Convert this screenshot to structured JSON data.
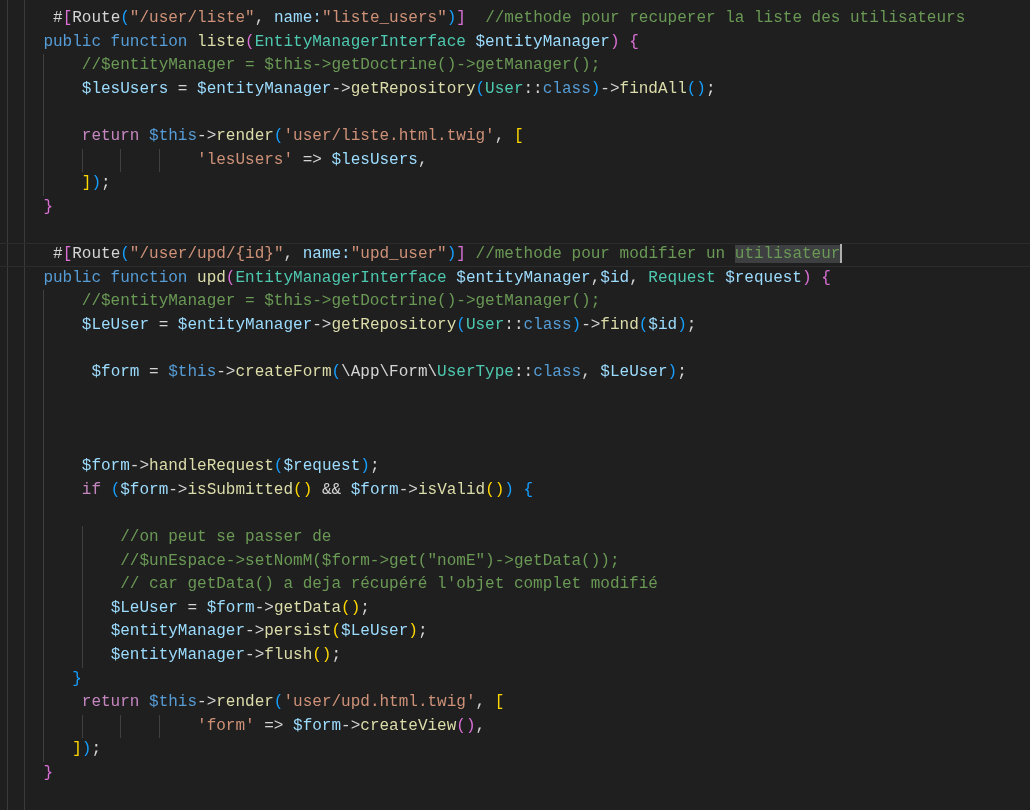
{
  "editor": {
    "lines": [
      {
        "current": false,
        "tokens": [
          {
            "kind": "op",
            "text": "     #"
          },
          {
            "kind": "b1",
            "text": "["
          },
          {
            "kind": "op",
            "text": "Route"
          },
          {
            "kind": "b2",
            "text": "("
          },
          {
            "kind": "str",
            "text": "\"/user/liste\""
          },
          {
            "kind": "op",
            "text": ", "
          },
          {
            "kind": "var",
            "text": "name:"
          },
          {
            "kind": "str",
            "text": "\"liste_users\""
          },
          {
            "kind": "b2",
            "text": ")"
          },
          {
            "kind": "b1",
            "text": "]"
          },
          {
            "kind": "com",
            "text": "  //methode pour recuperer la liste des utilisateurs"
          }
        ]
      },
      {
        "current": false,
        "tokens": [
          {
            "kind": "kw",
            "text": "    public function "
          },
          {
            "kind": "fn",
            "text": "liste"
          },
          {
            "kind": "b1",
            "text": "("
          },
          {
            "kind": "type",
            "text": "EntityManagerInterface "
          },
          {
            "kind": "var",
            "text": "$entityManager"
          },
          {
            "kind": "b1",
            "text": ")"
          },
          {
            "kind": "b1",
            "text": " {"
          }
        ]
      },
      {
        "current": false,
        "tokens": [
          {
            "kind": "com",
            "text": "        //$entityManager = $this->getDoctrine()->getManager();"
          }
        ]
      },
      {
        "current": false,
        "tokens": [
          {
            "kind": "var",
            "text": "        $lesUsers"
          },
          {
            "kind": "op",
            "text": " = "
          },
          {
            "kind": "var",
            "text": "$entityManager"
          },
          {
            "kind": "op",
            "text": "->"
          },
          {
            "kind": "fn",
            "text": "getRepository"
          },
          {
            "kind": "b2",
            "text": "("
          },
          {
            "kind": "type",
            "text": "User"
          },
          {
            "kind": "op",
            "text": "::"
          },
          {
            "kind": "kw",
            "text": "class"
          },
          {
            "kind": "b2",
            "text": ")"
          },
          {
            "kind": "op",
            "text": "->"
          },
          {
            "kind": "fn",
            "text": "findAll"
          },
          {
            "kind": "b2",
            "text": "()"
          },
          {
            "kind": "op",
            "text": ";"
          }
        ]
      },
      {
        "current": false
      },
      {
        "current": false,
        "tokens": [
          {
            "kind": "ctl",
            "text": "        return "
          },
          {
            "kind": "kw",
            "text": "$this"
          },
          {
            "kind": "op",
            "text": "->"
          },
          {
            "kind": "fn",
            "text": "render"
          },
          {
            "kind": "b2",
            "text": "("
          },
          {
            "kind": "str",
            "text": "'user/liste.html.twig'"
          },
          {
            "kind": "op",
            "text": ", "
          },
          {
            "kind": "b3",
            "text": "["
          }
        ]
      },
      {
        "current": false,
        "tokens": [
          {
            "kind": "str",
            "text": "                    'lesUsers'"
          },
          {
            "kind": "op",
            "text": " => "
          },
          {
            "kind": "var",
            "text": "$lesUsers"
          },
          {
            "kind": "op",
            "text": ","
          }
        ]
      },
      {
        "current": false,
        "tokens": [
          {
            "kind": "b3",
            "text": "        ]"
          },
          {
            "kind": "b2",
            "text": ")"
          },
          {
            "kind": "op",
            "text": ";"
          }
        ]
      },
      {
        "current": false,
        "tokens": [
          {
            "kind": "b1",
            "text": "    }"
          }
        ]
      },
      {
        "current": false
      },
      {
        "current": true,
        "tokens": [
          {
            "kind": "op",
            "text": "     #"
          },
          {
            "kind": "b1",
            "text": "["
          },
          {
            "kind": "op",
            "text": "Route"
          },
          {
            "kind": "b2",
            "text": "("
          },
          {
            "kind": "str",
            "text": "\"/user/upd/{id}\""
          },
          {
            "kind": "op",
            "text": ", "
          },
          {
            "kind": "var",
            "text": "name:"
          },
          {
            "kind": "str",
            "text": "\"upd_user\""
          },
          {
            "kind": "b2",
            "text": ")"
          },
          {
            "kind": "b1",
            "text": "]"
          },
          {
            "kind": "com",
            "text": " //methode pour modifier un "
          },
          {
            "kind": "com",
            "text": "utilisateur",
            "selected": true
          }
        ]
      },
      {
        "current": false,
        "tokens": [
          {
            "kind": "kw",
            "text": "    public function "
          },
          {
            "kind": "fn",
            "text": "upd"
          },
          {
            "kind": "b1",
            "text": "("
          },
          {
            "kind": "type",
            "text": "EntityManagerInterface "
          },
          {
            "kind": "var",
            "text": "$entityManager"
          },
          {
            "kind": "op",
            "text": ","
          },
          {
            "kind": "var",
            "text": "$id"
          },
          {
            "kind": "op",
            "text": ", "
          },
          {
            "kind": "type",
            "text": "Request "
          },
          {
            "kind": "var",
            "text": "$request"
          },
          {
            "kind": "b1",
            "text": ")"
          },
          {
            "kind": "b1",
            "text": " {"
          }
        ]
      },
      {
        "current": false,
        "tokens": [
          {
            "kind": "com",
            "text": "        //$entityManager = $this->getDoctrine()->getManager();"
          }
        ]
      },
      {
        "current": false,
        "tokens": [
          {
            "kind": "var",
            "text": "        $LeUser"
          },
          {
            "kind": "op",
            "text": " = "
          },
          {
            "kind": "var",
            "text": "$entityManager"
          },
          {
            "kind": "op",
            "text": "->"
          },
          {
            "kind": "fn",
            "text": "getRepository"
          },
          {
            "kind": "b2",
            "text": "("
          },
          {
            "kind": "type",
            "text": "User"
          },
          {
            "kind": "op",
            "text": "::"
          },
          {
            "kind": "kw",
            "text": "class"
          },
          {
            "kind": "b2",
            "text": ")"
          },
          {
            "kind": "op",
            "text": "->"
          },
          {
            "kind": "fn",
            "text": "find"
          },
          {
            "kind": "b2",
            "text": "("
          },
          {
            "kind": "var",
            "text": "$id"
          },
          {
            "kind": "b2",
            "text": ")"
          },
          {
            "kind": "op",
            "text": ";"
          }
        ]
      },
      {
        "current": false
      },
      {
        "current": false,
        "tokens": [
          {
            "kind": "var",
            "text": "         $form"
          },
          {
            "kind": "op",
            "text": " = "
          },
          {
            "kind": "kw",
            "text": "$this"
          },
          {
            "kind": "op",
            "text": "->"
          },
          {
            "kind": "fn",
            "text": "createForm"
          },
          {
            "kind": "b2",
            "text": "("
          },
          {
            "kind": "op",
            "text": "\\App\\Form\\"
          },
          {
            "kind": "type",
            "text": "UserType"
          },
          {
            "kind": "op",
            "text": "::"
          },
          {
            "kind": "kw",
            "text": "class"
          },
          {
            "kind": "op",
            "text": ", "
          },
          {
            "kind": "var",
            "text": "$LeUser"
          },
          {
            "kind": "b2",
            "text": ")"
          },
          {
            "kind": "op",
            "text": ";"
          }
        ]
      },
      {
        "current": false
      },
      {
        "current": false
      },
      {
        "current": false
      },
      {
        "current": false,
        "tokens": [
          {
            "kind": "var",
            "text": "        $form"
          },
          {
            "kind": "op",
            "text": "->"
          },
          {
            "kind": "fn",
            "text": "handleRequest"
          },
          {
            "kind": "b2",
            "text": "("
          },
          {
            "kind": "var",
            "text": "$request"
          },
          {
            "kind": "b2",
            "text": ")"
          },
          {
            "kind": "op",
            "text": ";"
          }
        ]
      },
      {
        "current": false,
        "tokens": [
          {
            "kind": "ctl",
            "text": "        if "
          },
          {
            "kind": "b2",
            "text": "("
          },
          {
            "kind": "var",
            "text": "$form"
          },
          {
            "kind": "op",
            "text": "->"
          },
          {
            "kind": "fn",
            "text": "isSubmitted"
          },
          {
            "kind": "b3",
            "text": "()"
          },
          {
            "kind": "op",
            "text": " && "
          },
          {
            "kind": "var",
            "text": "$form"
          },
          {
            "kind": "op",
            "text": "->"
          },
          {
            "kind": "fn",
            "text": "isValid"
          },
          {
            "kind": "b3",
            "text": "()"
          },
          {
            "kind": "b2",
            "text": ")"
          },
          {
            "kind": "b2",
            "text": " {"
          }
        ]
      },
      {
        "current": false
      },
      {
        "current": false,
        "tokens": [
          {
            "kind": "com",
            "text": "            //on peut se passer de"
          }
        ]
      },
      {
        "current": false,
        "tokens": [
          {
            "kind": "com",
            "text": "            //$unEspace->setNomM($form->get(\"nomE\")->getData());"
          }
        ]
      },
      {
        "current": false,
        "tokens": [
          {
            "kind": "com",
            "text": "            // car getData() a deja récupéré l'objet complet modifié"
          }
        ]
      },
      {
        "current": false,
        "tokens": [
          {
            "kind": "var",
            "text": "           $LeUser"
          },
          {
            "kind": "op",
            "text": " = "
          },
          {
            "kind": "var",
            "text": "$form"
          },
          {
            "kind": "op",
            "text": "->"
          },
          {
            "kind": "fn",
            "text": "getData"
          },
          {
            "kind": "b3",
            "text": "()"
          },
          {
            "kind": "op",
            "text": ";"
          }
        ]
      },
      {
        "current": false,
        "tokens": [
          {
            "kind": "var",
            "text": "           $entityManager"
          },
          {
            "kind": "op",
            "text": "->"
          },
          {
            "kind": "fn",
            "text": "persist"
          },
          {
            "kind": "b3",
            "text": "("
          },
          {
            "kind": "var",
            "text": "$LeUser"
          },
          {
            "kind": "b3",
            "text": ")"
          },
          {
            "kind": "op",
            "text": ";"
          }
        ]
      },
      {
        "current": false,
        "tokens": [
          {
            "kind": "var",
            "text": "           $entityManager"
          },
          {
            "kind": "op",
            "text": "->"
          },
          {
            "kind": "fn",
            "text": "flush"
          },
          {
            "kind": "b3",
            "text": "()"
          },
          {
            "kind": "op",
            "text": ";"
          }
        ]
      },
      {
        "current": false,
        "tokens": [
          {
            "kind": "b2",
            "text": "       }"
          }
        ]
      },
      {
        "current": false,
        "tokens": [
          {
            "kind": "ctl",
            "text": "        return "
          },
          {
            "kind": "kw",
            "text": "$this"
          },
          {
            "kind": "op",
            "text": "->"
          },
          {
            "kind": "fn",
            "text": "render"
          },
          {
            "kind": "b2",
            "text": "("
          },
          {
            "kind": "str",
            "text": "'user/upd.html.twig'"
          },
          {
            "kind": "op",
            "text": ", "
          },
          {
            "kind": "b3",
            "text": "["
          }
        ]
      },
      {
        "current": false,
        "tokens": [
          {
            "kind": "str",
            "text": "                    'form'"
          },
          {
            "kind": "op",
            "text": " => "
          },
          {
            "kind": "var",
            "text": "$form"
          },
          {
            "kind": "op",
            "text": "->"
          },
          {
            "kind": "fn",
            "text": "createView"
          },
          {
            "kind": "b1",
            "text": "()"
          },
          {
            "kind": "op",
            "text": ","
          }
        ]
      },
      {
        "current": false,
        "tokens": [
          {
            "kind": "b3",
            "text": "       ]"
          },
          {
            "kind": "b2",
            "text": ")"
          },
          {
            "kind": "op",
            "text": ";"
          }
        ]
      },
      {
        "current": false,
        "tokens": [
          {
            "kind": "b1",
            "text": "    }"
          }
        ]
      },
      {
        "current": false
      }
    ]
  }
}
